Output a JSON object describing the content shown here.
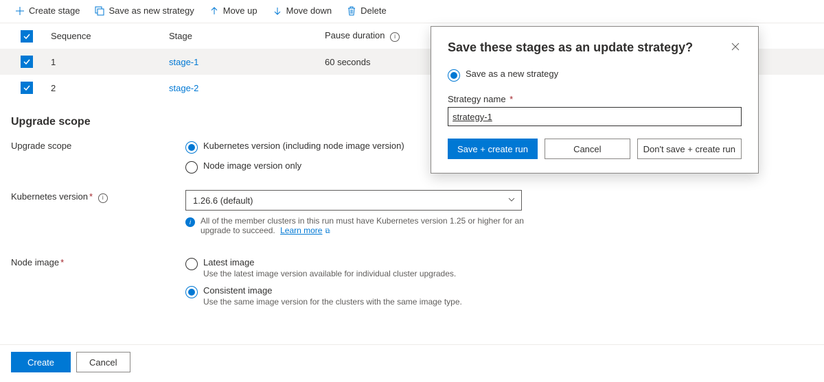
{
  "toolbar": {
    "create_stage": "Create stage",
    "save_as_new_strategy": "Save as new strategy",
    "move_up": "Move up",
    "move_down": "Move down",
    "delete": "Delete"
  },
  "table": {
    "headers": {
      "sequence": "Sequence",
      "stage": "Stage",
      "pause": "Pause duration"
    },
    "rows": [
      {
        "sequence": "1",
        "stage": "stage-1",
        "pause": "60 seconds"
      },
      {
        "sequence": "2",
        "stage": "stage-2",
        "pause": ""
      }
    ]
  },
  "scope": {
    "section_title": "Upgrade scope",
    "label": "Upgrade scope",
    "option_full": "Kubernetes version (including node image version)",
    "option_node_only": "Node image version only"
  },
  "k8s": {
    "label": "Kubernetes version",
    "selected": "1.26.6 (default)",
    "help_text": "All of the member clusters in this run must have Kubernetes version 1.25 or higher for an upgrade to succeed.",
    "learn_more": "Learn more"
  },
  "node_image": {
    "label": "Node image",
    "latest_title": "Latest image",
    "latest_desc": "Use the latest image version available for individual cluster upgrades.",
    "consistent_title": "Consistent image",
    "consistent_desc": "Use the same image version for the clusters with the same image type."
  },
  "footer": {
    "create": "Create",
    "cancel": "Cancel"
  },
  "dialog": {
    "title": "Save these stages as an update strategy?",
    "save_new": "Save as a new strategy",
    "name_label": "Strategy name",
    "name_value": "strategy-1",
    "save_create": "Save + create run",
    "cancel": "Cancel",
    "dont_save": "Don't save + create run"
  }
}
